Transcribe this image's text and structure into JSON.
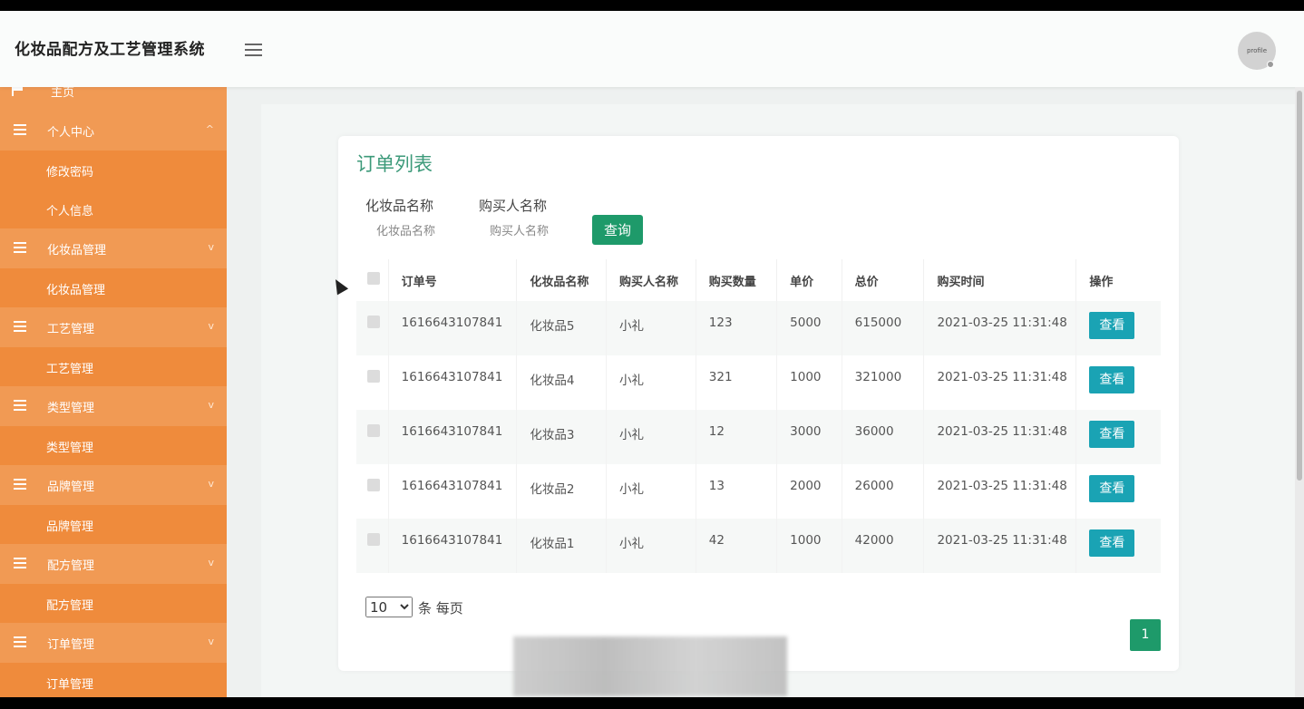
{
  "header": {
    "title": "化妆品配方及工艺管理系统",
    "avatar_text": "profile"
  },
  "sidebar": {
    "home_label": "主页",
    "groups": [
      {
        "label": "个人中心",
        "chevron": "^",
        "items": [
          "修改密码",
          "个人信息"
        ]
      },
      {
        "label": "化妆品管理",
        "chevron": "v",
        "items": [
          "化妆品管理"
        ]
      },
      {
        "label": "工艺管理",
        "chevron": "v",
        "items": [
          "工艺管理"
        ]
      },
      {
        "label": "类型管理",
        "chevron": "v",
        "items": [
          "类型管理"
        ]
      },
      {
        "label": "品牌管理",
        "chevron": "v",
        "items": [
          "品牌管理"
        ]
      },
      {
        "label": "配方管理",
        "chevron": "v",
        "items": [
          "配方管理"
        ]
      },
      {
        "label": "订单管理",
        "chevron": "v",
        "items": [
          "订单管理"
        ]
      }
    ]
  },
  "main": {
    "title": "订单列表",
    "filters": {
      "cosmetic_label": "化妆品名称",
      "cosmetic_placeholder": "化妆品名称",
      "buyer_label": "购买人名称",
      "buyer_placeholder": "购买人名称",
      "search_label": "查询"
    },
    "table": {
      "columns": [
        "订单号",
        "化妆品名称",
        "购买人名称",
        "购买数量",
        "单价",
        "总价",
        "购买时间",
        "操作"
      ],
      "rows": [
        {
          "order_no": "1616643107841",
          "cosmetic": "化妆品5",
          "buyer": "小礼",
          "qty": "123",
          "price": "5000",
          "total": "615000",
          "time": "2021-03-25 11:31:48",
          "action": "查看"
        },
        {
          "order_no": "1616643107841",
          "cosmetic": "化妆品4",
          "buyer": "小礼",
          "qty": "321",
          "price": "1000",
          "total": "321000",
          "time": "2021-03-25 11:31:48",
          "action": "查看"
        },
        {
          "order_no": "1616643107841",
          "cosmetic": "化妆品3",
          "buyer": "小礼",
          "qty": "12",
          "price": "3000",
          "total": "36000",
          "time": "2021-03-25 11:31:48",
          "action": "查看"
        },
        {
          "order_no": "1616643107841",
          "cosmetic": "化妆品2",
          "buyer": "小礼",
          "qty": "13",
          "price": "2000",
          "total": "26000",
          "time": "2021-03-25 11:31:48",
          "action": "查看"
        },
        {
          "order_no": "1616643107841",
          "cosmetic": "化妆品1",
          "buyer": "小礼",
          "qty": "42",
          "price": "1000",
          "total": "42000",
          "time": "2021-03-25 11:31:48",
          "action": "查看"
        }
      ]
    },
    "pagination": {
      "page_size": "10",
      "per_page_text": "条 每页",
      "current_page": "1"
    }
  },
  "colors": {
    "sidebar": "#ef8b3c",
    "accent_green": "#1e9a6a",
    "view_button": "#1aa3b4"
  }
}
